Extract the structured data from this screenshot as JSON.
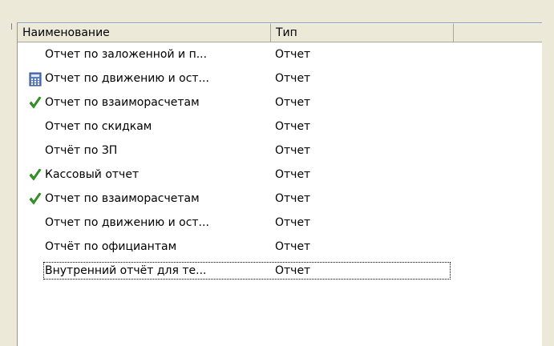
{
  "columns": {
    "name": "Наименование",
    "type": "Тип",
    "extra": ""
  },
  "rows": [
    {
      "name": "Отчет по заложенной и п...",
      "type": "Отчет",
      "icon": "none"
    },
    {
      "name": "Отчет по движению и ост...",
      "type": "Отчет",
      "icon": "calculator-icon"
    },
    {
      "name": "Отчет по взаиморасчетам",
      "type": "Отчет",
      "icon": "check-icon"
    },
    {
      "name": "Отчет по скидкам",
      "type": "Отчет",
      "icon": "none"
    },
    {
      "name": "Отчёт по ЗП",
      "type": "Отчет",
      "icon": "none"
    },
    {
      "name": "Кассовый отчет",
      "type": "Отчет",
      "icon": "check-icon"
    },
    {
      "name": "Отчет по взаиморасчетам",
      "type": "Отчет",
      "icon": "check-icon"
    },
    {
      "name": "Отчет по движению и ост...",
      "type": "Отчет",
      "icon": "none"
    },
    {
      "name": "Отчёт по официантам",
      "type": "Отчет",
      "icon": "none"
    },
    {
      "name": "Внутренний отчёт для те...",
      "type": "Отчет",
      "icon": "none",
      "focused": true
    }
  ],
  "colors": {
    "check": "#2e9b1f",
    "header_bg": "#ece9d8",
    "list_bg": "#ffffff"
  }
}
